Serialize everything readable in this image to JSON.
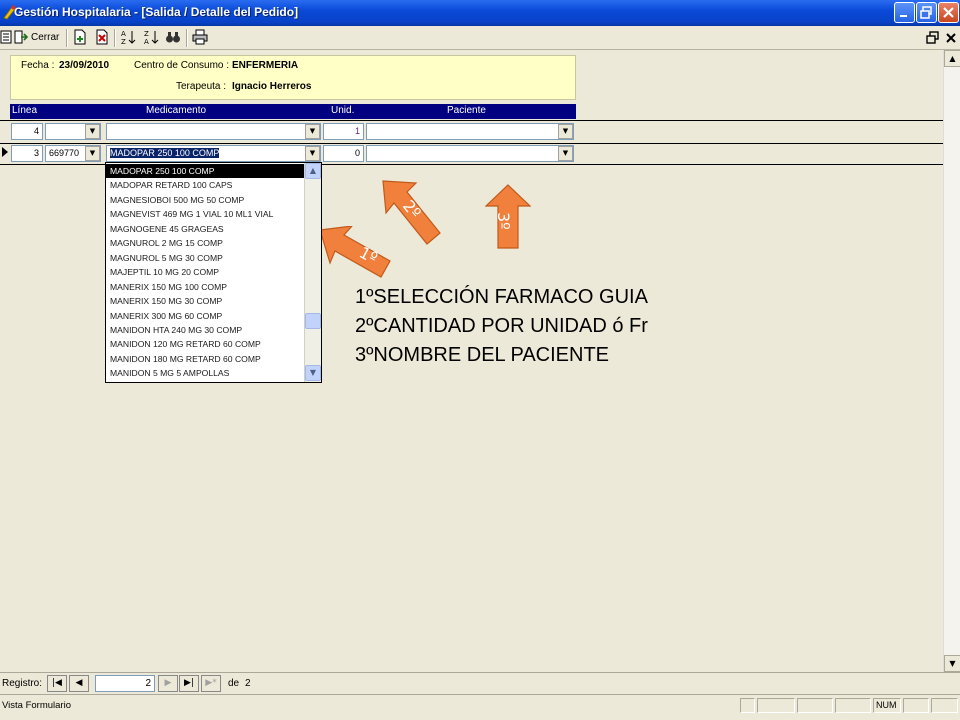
{
  "window": {
    "title": "Gestión Hospitalaria - [Salida / Detalle del Pedido]",
    "minimize_icon": "minimize-icon",
    "maximize_icon": "maximize-icon",
    "close_icon": "close-icon"
  },
  "toolbar": {
    "close_label": "Cerrar",
    "icons": [
      "close-form-icon",
      "add-record-icon",
      "delete-record-icon",
      "sort-ascending-icon",
      "sort-descending-icon",
      "find-icon",
      "print-icon"
    ]
  },
  "header": {
    "fecha_label": "Fecha :",
    "fecha_value": "23/09/2010",
    "centro_label": "Centro de Consumo :",
    "centro_value": "ENFERMERIA",
    "terapeuta_label": "Terapeuta :",
    "terapeuta_value": "Ignacio Herreros"
  },
  "grid": {
    "columns": [
      "Línea",
      "Medicamento",
      "Unid.",
      "Paciente"
    ],
    "rows": [
      {
        "linea": "4",
        "codigo": "",
        "medicamento": "",
        "unid": "1",
        "paciente": ""
      },
      {
        "linea": "3",
        "codigo": "669770",
        "medicamento": "MADOPAR 250 100 COMP",
        "unid": "0",
        "paciente": ""
      }
    ]
  },
  "dropdown": {
    "items": [
      "MADOPAR 250 100 COMP",
      "MADOPAR RETARD 100 CAPS",
      "MAGNESIOBOI  500 MG  50 COMP",
      "MAGNEVIST 469 MG 1 VIAL 10 ML1 VIAL",
      "MAGNOGENE 45 GRAGEAS",
      "MAGNUROL 2 MG 15 COMP",
      "MAGNUROL 5 MG 30 COMP",
      "MAJEPTIL 10 MG 20 COMP",
      "MANERIX 150 MG  100 COMP",
      "MANERIX 150 MG 30 COMP",
      "MANERIX 300 MG 60 COMP",
      "MANIDON  HTA  240 MG 30 COMP",
      "MANIDON 120  MG RETARD 60 COMP",
      "MANIDON 180 MG RETARD 60 COMP",
      "MANIDON 5 MG 5 AMPOLLAS"
    ],
    "selected_index": 0
  },
  "annotations": {
    "arrow1": "1º",
    "arrow2": "2º",
    "arrow3": "3º",
    "arrow_color": "#f0803c",
    "note1": "1ºSELECCIÓN FARMACO GUIA",
    "note2": "2ºCANTIDAD POR UNIDAD ó Fr",
    "note3": "3ºNOMBRE DEL PACIENTE"
  },
  "navigator": {
    "label": "Registro:",
    "current": "2",
    "of_label": "de",
    "total": "2"
  },
  "status": {
    "text": "Vista Formulario",
    "num": "NUM"
  }
}
